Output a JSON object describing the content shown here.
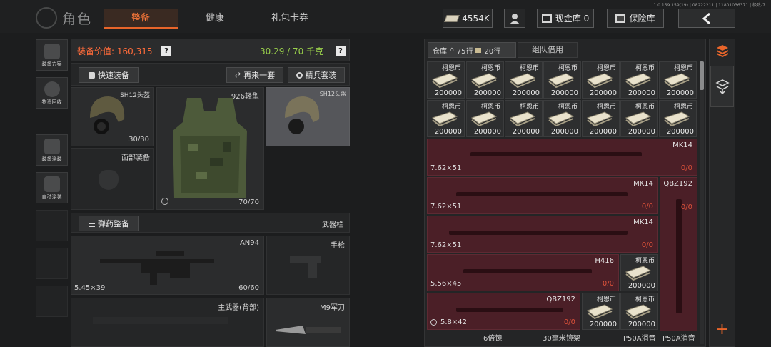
{
  "header": {
    "title": "角色",
    "tabs": [
      {
        "label": "整备",
        "active": true
      },
      {
        "label": "健康",
        "active": false
      },
      {
        "label": "礼包卡券",
        "active": false
      }
    ],
    "version": "1.0.159.159(19) | 08222211 | 11801036371 | 极致-7",
    "currency_value": "4554K",
    "cash_vault_label": "现金库 0",
    "safe_label": "保险库"
  },
  "sidebar": {
    "items": [
      {
        "label": "装备方案",
        "icon": "gear-loadout-icon"
      },
      {
        "label": "物资回收",
        "icon": "recycle-icon"
      },
      {
        "label": "装备涂装",
        "icon": "skin-icon"
      },
      {
        "label": "自动涂装",
        "icon": "auto-paint-icon"
      }
    ]
  },
  "loadout": {
    "value_label": "装备价值: 160,315",
    "weight_label": "30.29 / 70 千克",
    "quick_equip": "快速装备",
    "again_set": "再来一套",
    "elite_set": "精兵套装",
    "helmet_name": "SH12头盔",
    "helmet_durability": "30/30",
    "face_slot": "面部装备",
    "armor_name": "926轻型",
    "armor_durability": "70/70",
    "helmet2_name": "SH12头盔",
    "ammo_equip": "弹药整备",
    "weapon_bar": "武器栏",
    "primary_name": "AN94",
    "primary_caliber": "5.45×39",
    "primary_ammo": "60/60",
    "pistol_slot": "手枪",
    "back_slot": "主武器(背部)",
    "melee_name": "M9军刀"
  },
  "storage": {
    "tab_warehouse": "仓库",
    "rows_a": "75行",
    "rows_b": "20行",
    "tab_team": "组队借用",
    "cash_name": "柯恩币",
    "cash_qty": "200000",
    "weapons": [
      {
        "name": "MK14",
        "caliber": "7.62×51",
        "count": "0/0"
      },
      {
        "name": "MK14",
        "caliber": "7.62×51",
        "count": "0/0"
      },
      {
        "name": "QBZ192",
        "caliber": "",
        "count": "0/0"
      },
      {
        "name": "MK14",
        "caliber": "7.62×51",
        "count": "0/0"
      },
      {
        "name": "H416",
        "caliber": "5.56×45",
        "count": "0/0"
      },
      {
        "name": "QBZ192",
        "caliber": "5.8×42",
        "count": "0/0"
      }
    ],
    "bottom_labels": [
      "6倍镜",
      "30毫米镜架",
      "P50A消音",
      "P50A消音"
    ]
  },
  "colors": {
    "accent": "#e8652a",
    "weight_green": "#9ad14b",
    "weapon_cell": "#4b1f27"
  }
}
